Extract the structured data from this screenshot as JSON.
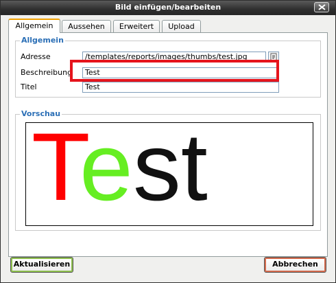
{
  "window": {
    "title": "Bild einfügen/bearbeiten"
  },
  "tabs": [
    {
      "label": "Allgemein",
      "active": true
    },
    {
      "label": "Aussehen",
      "active": false
    },
    {
      "label": "Erweitert",
      "active": false
    },
    {
      "label": "Upload",
      "active": false
    }
  ],
  "general": {
    "legend": "Allgemein",
    "address_label": "Adresse",
    "address_value": "/templates/reports/images/thumbs/test.jpg",
    "description_label": "Beschreibung",
    "description_value": "Test",
    "title_label": "Titel",
    "title_value": "Test"
  },
  "preview": {
    "legend": "Vorschau",
    "image_text": "Test",
    "letter_colors": [
      "#ff0000",
      "#66ee22",
      "#111111",
      "#111111"
    ]
  },
  "buttons": {
    "update_label": "Aktualisieren",
    "cancel_label": "Abbrechen"
  },
  "colors": {
    "highlight": "#e5141c",
    "legend_text": "#2b6fb6",
    "active_tab_accent": "#f0a000"
  },
  "icons": {
    "close": "close-icon",
    "browse": "browse-icon"
  }
}
